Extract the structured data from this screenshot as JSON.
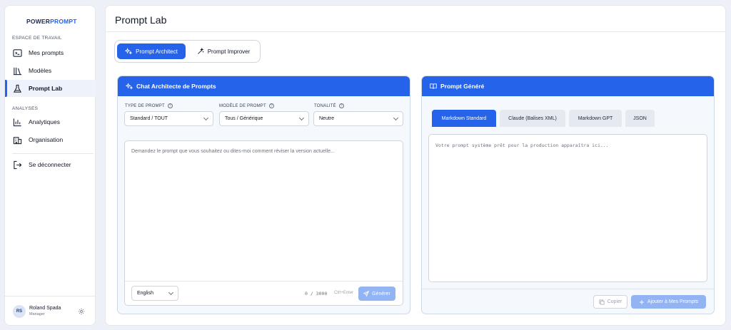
{
  "brand": {
    "part1": "POWER",
    "part2": "PROMPT"
  },
  "sidebar": {
    "section_workspace": "ESPACE DE TRAVAIL",
    "section_analytics": "ANALYSES",
    "items": [
      {
        "label": "Mes prompts",
        "icon": "terminal-icon"
      },
      {
        "label": "Modèles",
        "icon": "library-icon"
      },
      {
        "label": "Prompt Lab",
        "icon": "flask-icon",
        "active": true
      },
      {
        "label": "Analytiques",
        "icon": "bar-chart-icon"
      },
      {
        "label": "Organisation",
        "icon": "building-icon"
      },
      {
        "label": "Se déconnecter",
        "icon": "logout-icon"
      }
    ],
    "user": {
      "initials": "RS",
      "name": "Roland Spada",
      "role": "Manager"
    }
  },
  "header": {
    "title": "Prompt Lab"
  },
  "modes": [
    {
      "label": "Prompt Architect",
      "active": true
    },
    {
      "label": "Prompt Improver"
    }
  ],
  "architect": {
    "title": "Chat Architecte de Prompts",
    "fields": {
      "type": {
        "label": "TYPE DE PROMPT",
        "value": "Standard / TOUT"
      },
      "model": {
        "label": "MODÈLE DE PROMPT",
        "value": "Tous / Générique"
      },
      "tone": {
        "label": "TONALITÉ",
        "value": "Neutre"
      }
    },
    "input_placeholder": "Demandez le prompt que vous souhaitez ou dites-moi comment réviser la version actuelle...",
    "language": "English",
    "counter": "0 / 3000",
    "shortcut": "Ctrl+Enter",
    "generate_label": "Générer"
  },
  "generated": {
    "title": "Prompt Généré",
    "tabs": [
      {
        "label": "Markdown Standard",
        "active": true
      },
      {
        "label": "Claude (Balises XML)"
      },
      {
        "label": "Markdown GPT"
      },
      {
        "label": "JSON"
      }
    ],
    "output_placeholder": "Votre prompt système prêt pour la production apparaîtra ici...",
    "copy_label": "Copier",
    "add_label": "Ajouter à Mes Prompts"
  },
  "colors": {
    "accent": "#2563eb",
    "disabled_accent": "#93b4f3"
  }
}
